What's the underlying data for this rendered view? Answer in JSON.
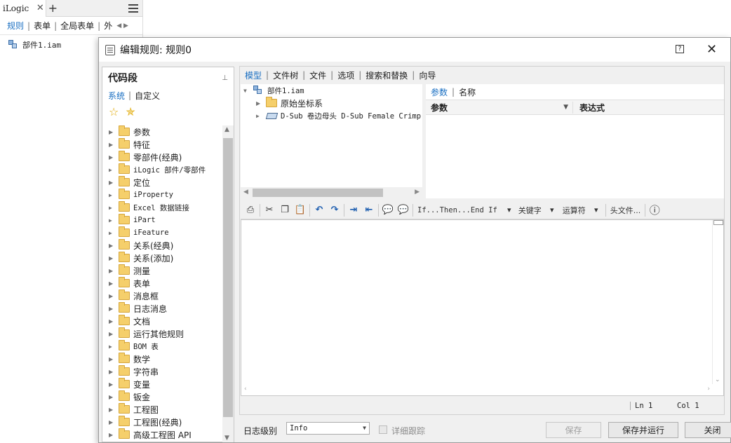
{
  "browser": {
    "tab_title": "iLogic",
    "subtabs": [
      "规则",
      "表单",
      "全局表单",
      "外"
    ],
    "file_name": "部件1.iam"
  },
  "dialog": {
    "title": "编辑规则: 规则0",
    "snippets": {
      "title": "代码段",
      "tabs": [
        "系统",
        "自定义"
      ],
      "items": [
        "参数",
        "特征",
        "零部件(经典)",
        "iLogic 部件/零部件",
        "定位",
        "iProperty",
        "Excel 数据链接",
        "iPart",
        "iFeature",
        "关系(经典)",
        "关系(添加)",
        "测量",
        "表单",
        "消息框",
        "日志消息",
        "文档",
        "运行其他规则",
        "BOM 表",
        "数学",
        "字符串",
        "变量",
        "钣金",
        "工程图",
        "工程图(经典)",
        "高级工程图 API"
      ]
    },
    "right_tabs": [
      "模型",
      "文件树",
      "文件",
      "选项",
      "搜索和替换",
      "向导"
    ],
    "model_tree": {
      "root": "部件1.iam",
      "children": [
        "原始坐标系",
        "D-Sub 卷边母头 D-Sub Female Crimp"
      ]
    },
    "param_tabs": [
      "参数",
      "名称"
    ],
    "param_columns": [
      "参数",
      "表达式"
    ],
    "toolbar": {
      "if_then": "If...Then...End If",
      "keywords": "关键字",
      "operators": "运算符",
      "header_file": "头文件..."
    },
    "status": {
      "ln": "Ln 1",
      "col": "Col 1"
    },
    "footer": {
      "log_level_label": "日志级别",
      "log_level_value": "Info",
      "detailed_trace": "详细跟踪",
      "save": "保存",
      "save_run": "保存并运行",
      "close": "关闭"
    }
  }
}
